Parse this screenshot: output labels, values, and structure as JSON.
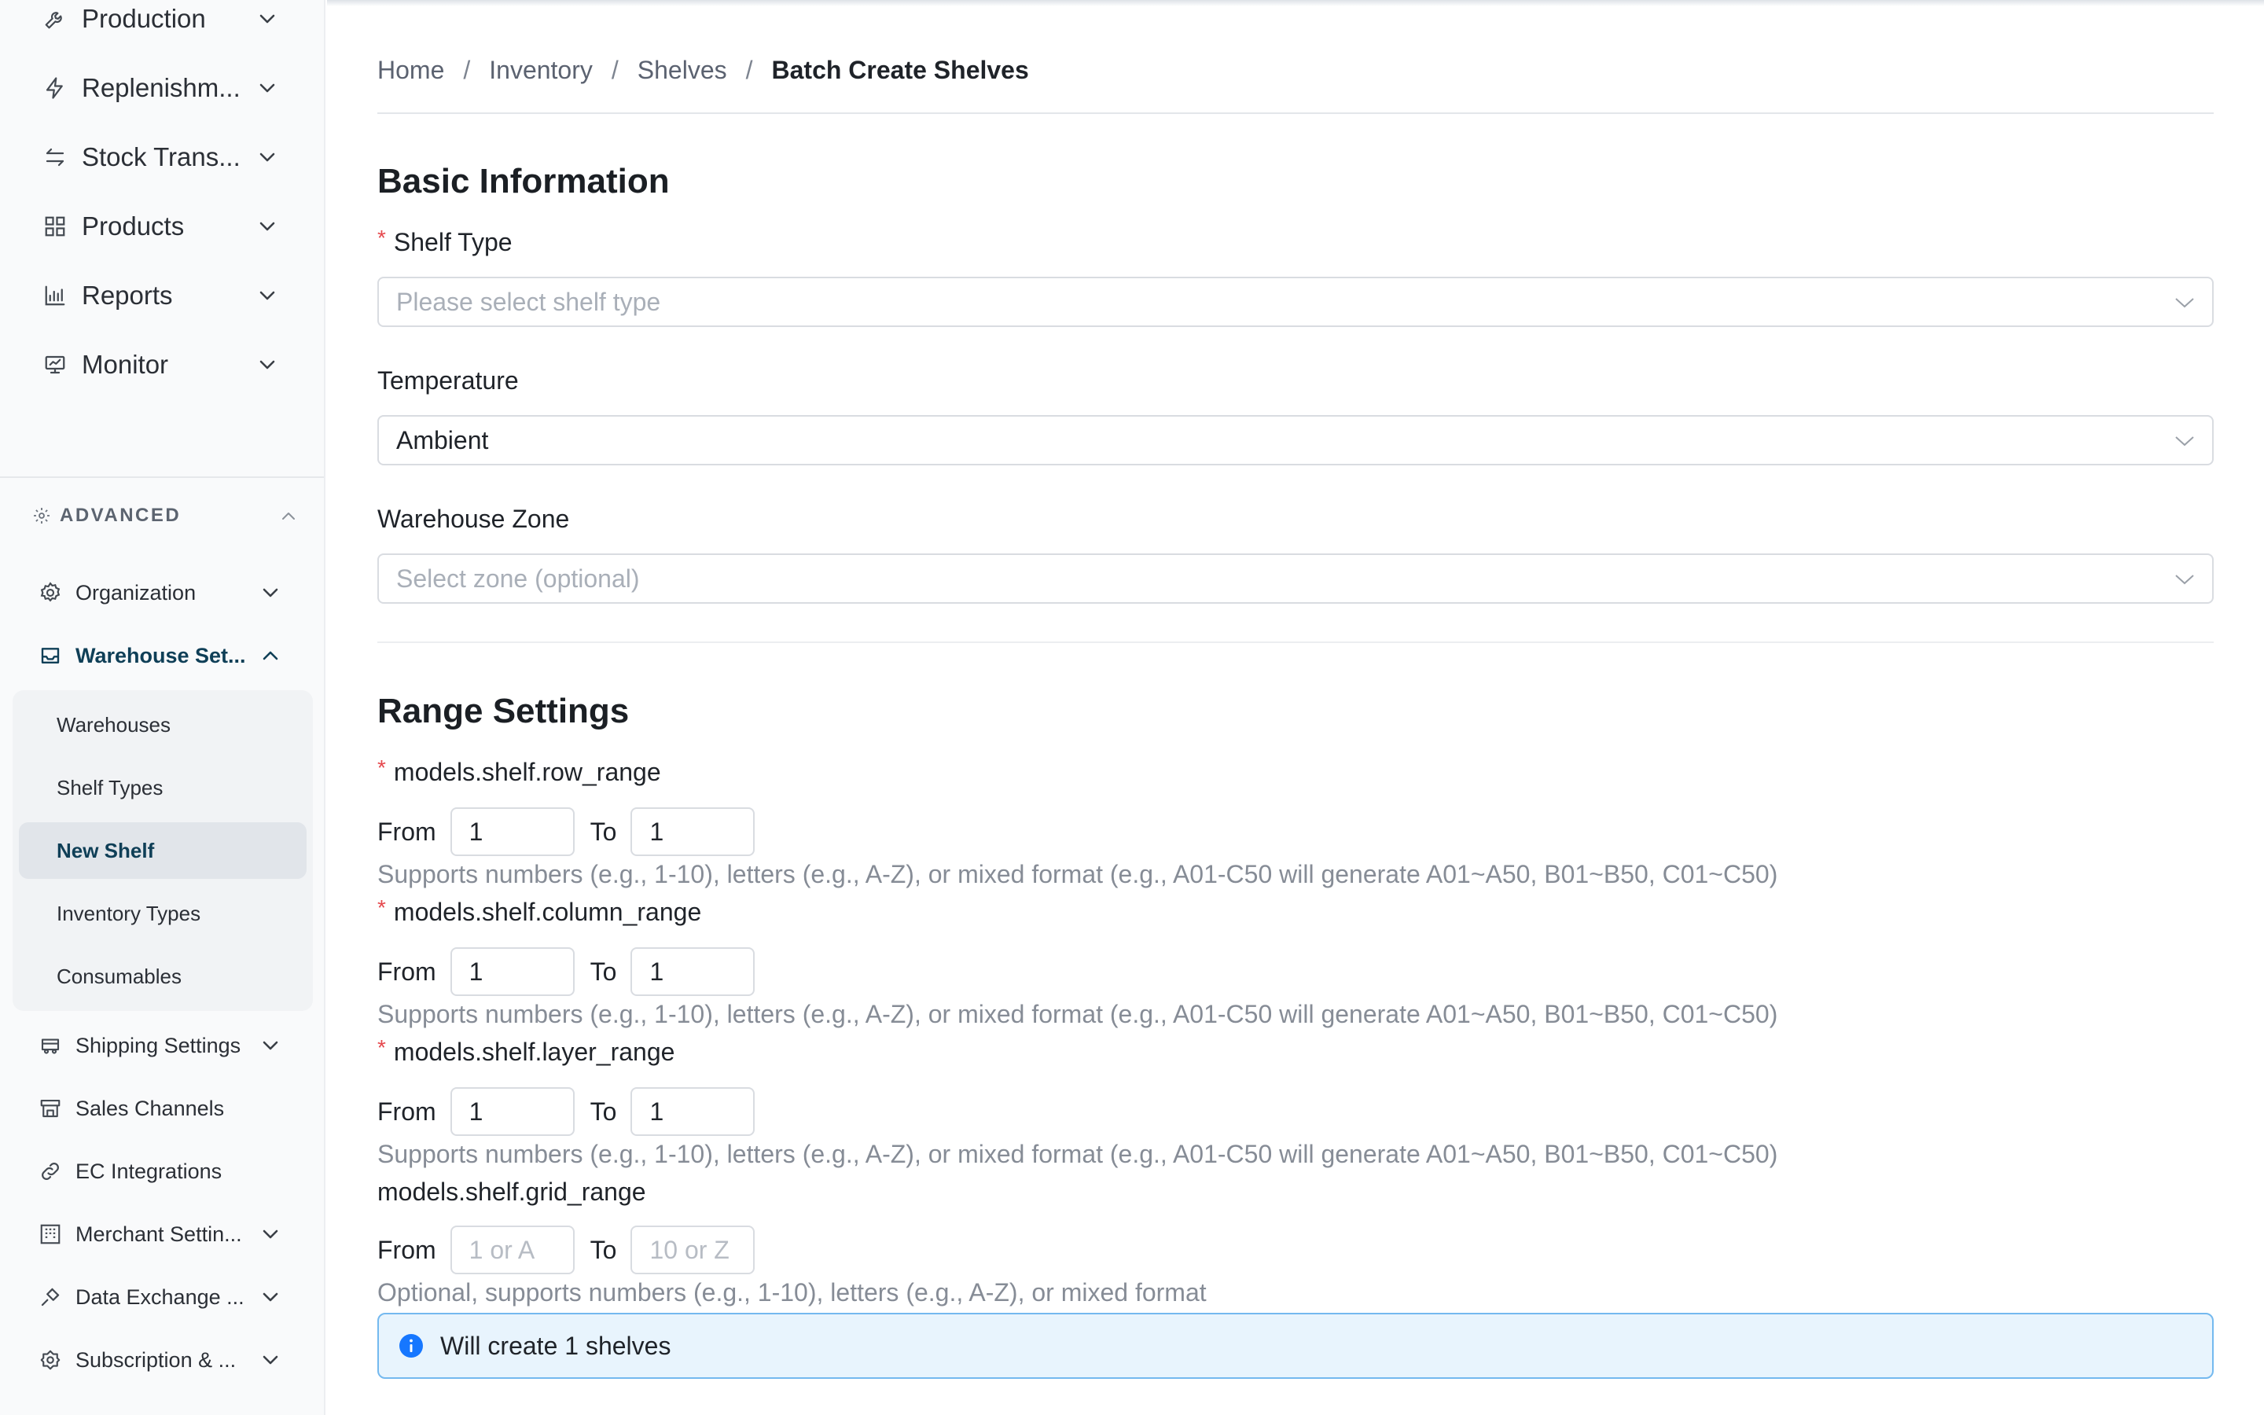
{
  "sidebar": {
    "top_items": [
      {
        "label": "Production",
        "icon": "wrench-icon"
      },
      {
        "label": "Replenishm...",
        "icon": "bolt-icon"
      },
      {
        "label": "Stock Trans...",
        "icon": "transfer-icon"
      },
      {
        "label": "Products",
        "icon": "grid-icon"
      },
      {
        "label": "Reports",
        "icon": "bar-chart-icon"
      },
      {
        "label": "Monitor",
        "icon": "monitor-icon"
      }
    ],
    "advanced": {
      "header": "ADVANCED",
      "items": [
        {
          "label": "Organization",
          "icon": "gear-icon"
        },
        {
          "label": "Warehouse Set...",
          "icon": "inbox-icon",
          "active": true
        },
        {
          "label": "Shipping Settings",
          "icon": "truck-icon"
        },
        {
          "label": "Sales Channels",
          "icon": "store-icon"
        },
        {
          "label": "EC Integrations",
          "icon": "link-icon"
        },
        {
          "label": "Merchant Settin...",
          "icon": "building-icon"
        },
        {
          "label": "Data Exchange ...",
          "icon": "plug-icon"
        },
        {
          "label": "Subscription & ...",
          "icon": "badge-icon"
        }
      ],
      "submenu": [
        {
          "label": "Warehouses"
        },
        {
          "label": "Shelf Types"
        },
        {
          "label": "New Shelf",
          "selected": true
        },
        {
          "label": "Inventory Types"
        },
        {
          "label": "Consumables"
        }
      ]
    }
  },
  "breadcrumb": {
    "home": "Home",
    "inventory": "Inventory",
    "shelves": "Shelves",
    "current": "Batch Create Shelves",
    "separator": "/"
  },
  "basic": {
    "title": "Basic Information",
    "shelf_type": {
      "label": "Shelf Type",
      "required_mark": "*",
      "placeholder": "Please select shelf type"
    },
    "temperature": {
      "label": "Temperature",
      "value": "Ambient"
    },
    "zone": {
      "label": "Warehouse Zone",
      "placeholder": "Select zone (optional)"
    }
  },
  "range": {
    "title": "Range Settings",
    "from_label": "From",
    "to_label": "To",
    "row": {
      "label": "models.shelf.row_range",
      "required_mark": "*",
      "from": "1",
      "to": "1",
      "hint": "Supports numbers (e.g., 1-10), letters (e.g., A-Z), or mixed format (e.g., A01-C50 will generate A01~A50, B01~B50, C01~C50)"
    },
    "column": {
      "label": "models.shelf.column_range",
      "required_mark": "*",
      "from": "1",
      "to": "1",
      "hint": "Supports numbers (e.g., 1-10), letters (e.g., A-Z), or mixed format (e.g., A01-C50 will generate A01~A50, B01~B50, C01~C50)"
    },
    "layer": {
      "label": "models.shelf.layer_range",
      "required_mark": "*",
      "from": "1",
      "to": "1",
      "hint": "Supports numbers (e.g., 1-10), letters (e.g., A-Z), or mixed format (e.g., A01-C50 will generate A01~A50, B01~B50, C01~C50)"
    },
    "grid": {
      "label": "models.shelf.grid_range",
      "from_placeholder": "1 or A",
      "to_placeholder": "10 or Z",
      "hint": "Optional, supports numbers (e.g., 1-10), letters (e.g., A-Z), or mixed format"
    }
  },
  "info": {
    "text": "Will create 1 shelves",
    "icon": "info-icon"
  },
  "colors": {
    "accent": "#0f3f57",
    "required": "#e5484d",
    "info_bg": "#e8f4fd",
    "info_border": "#74b9ef",
    "info_icon": "#1677ff"
  }
}
